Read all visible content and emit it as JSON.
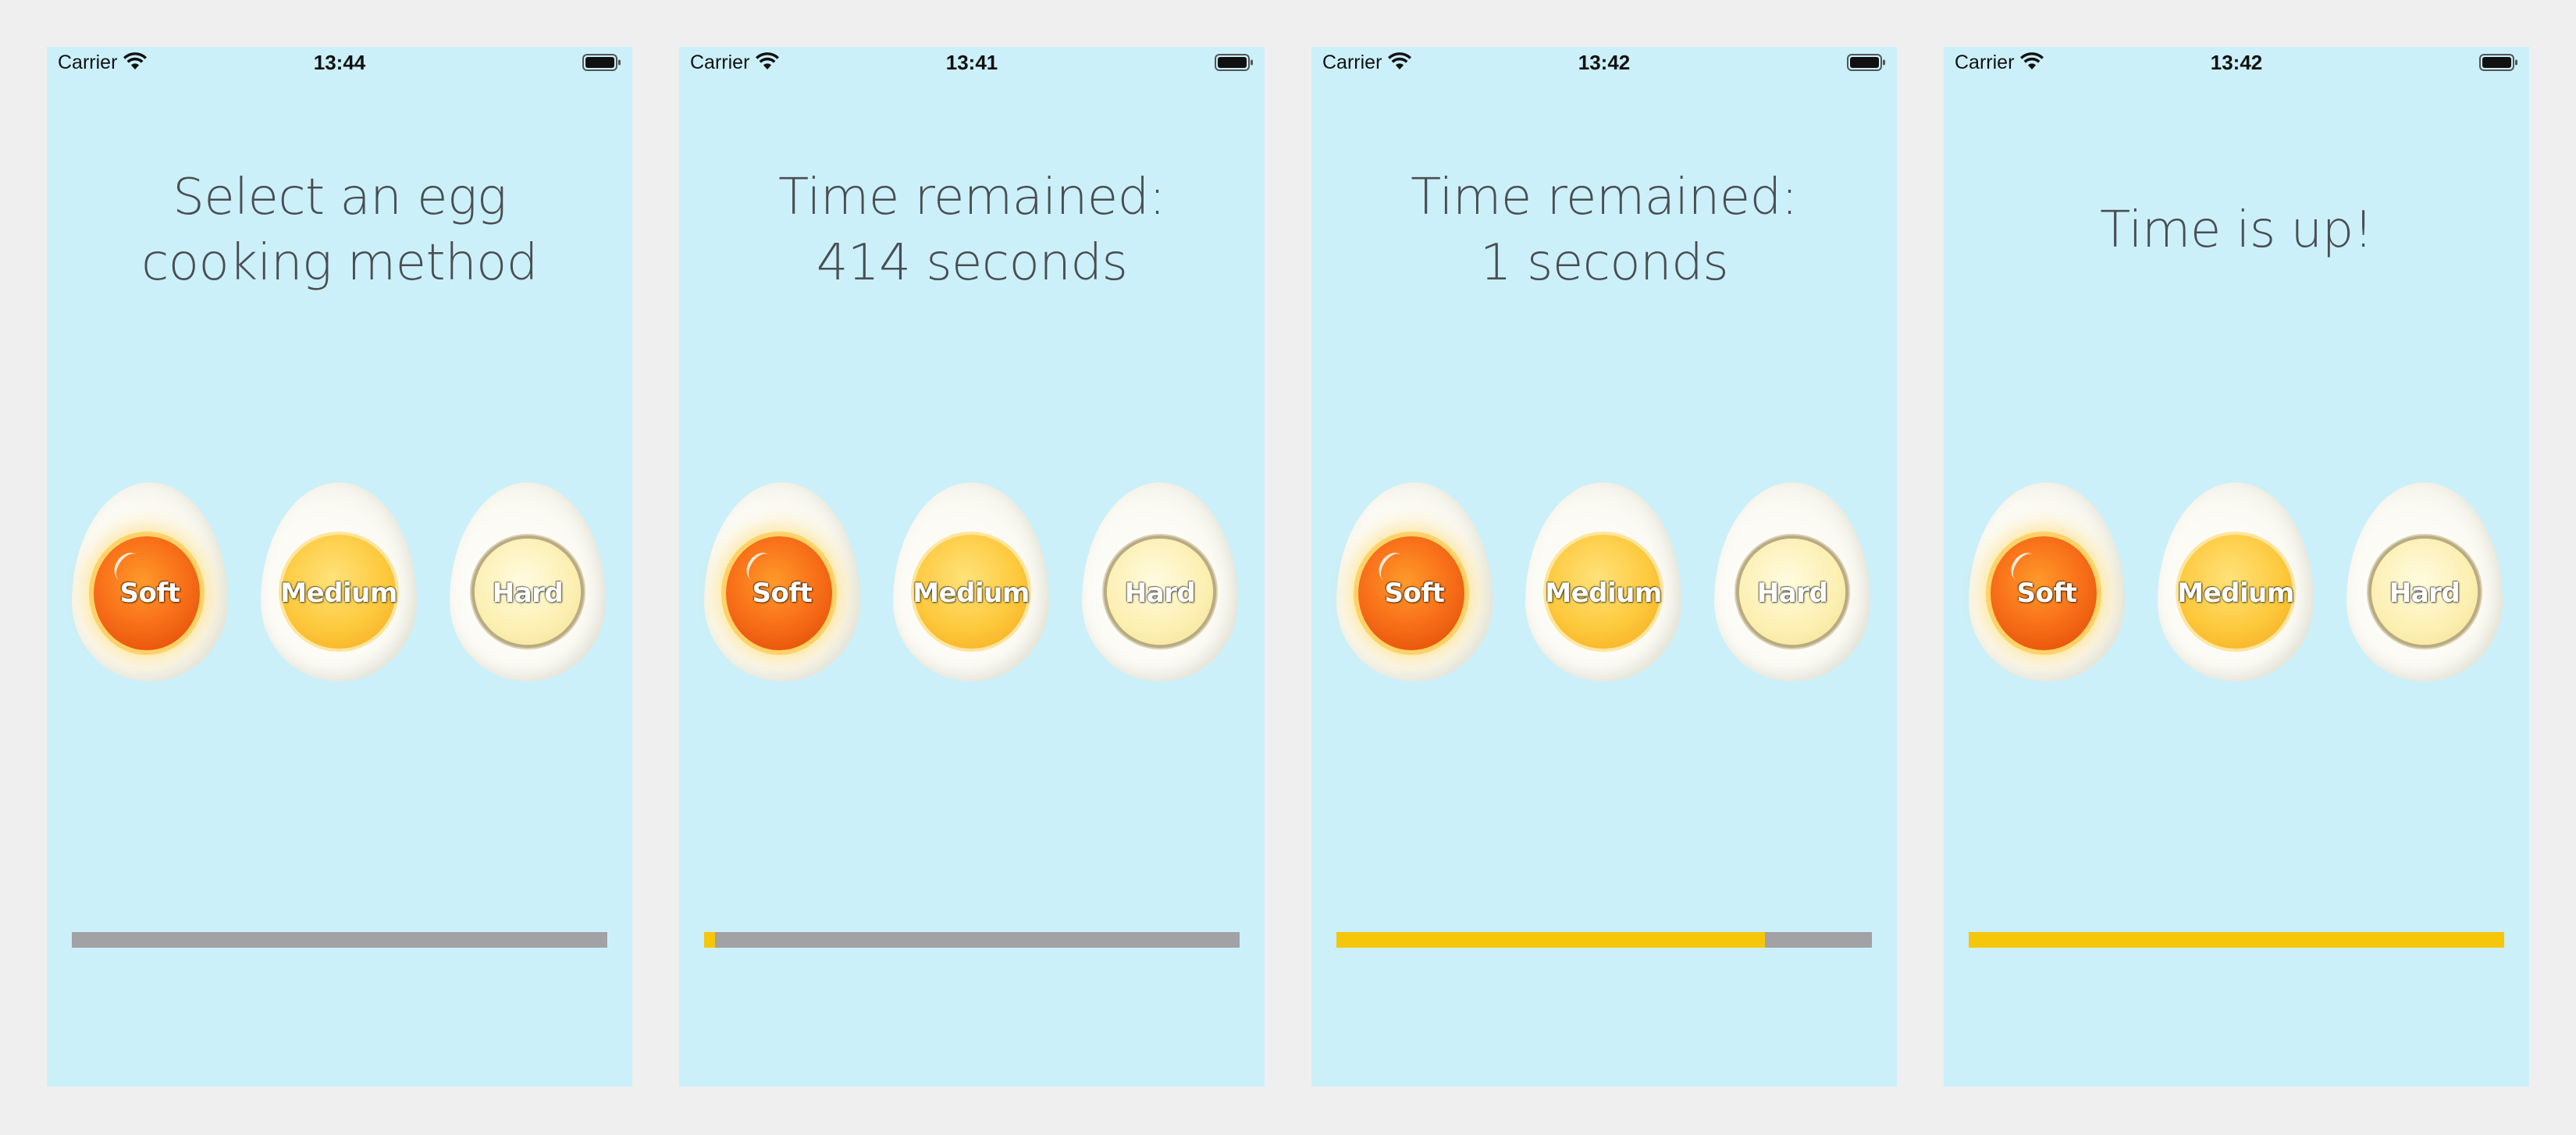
{
  "colors": {
    "background": "#cbf0f9",
    "progress_track": "#a1a1a6",
    "progress_fill": "#f5c60a"
  },
  "icons": [
    "wifi-icon",
    "battery-icon"
  ],
  "screens": [
    {
      "status": {
        "carrier": "Carrier",
        "time": "13:44"
      },
      "title": "Select an egg\ncooking method",
      "eggs": [
        {
          "label": "Soft"
        },
        {
          "label": "Medium"
        },
        {
          "label": "Hard"
        }
      ],
      "progress": 0
    },
    {
      "status": {
        "carrier": "Carrier",
        "time": "13:41"
      },
      "title": "Time remained:\n414 seconds",
      "eggs": [
        {
          "label": "Soft"
        },
        {
          "label": "Medium"
        },
        {
          "label": "Hard"
        }
      ],
      "progress": 0.02
    },
    {
      "status": {
        "carrier": "Carrier",
        "time": "13:42"
      },
      "title": "Time remained:\n1 seconds",
      "eggs": [
        {
          "label": "Soft"
        },
        {
          "label": "Medium"
        },
        {
          "label": "Hard"
        }
      ],
      "progress": 0.8
    },
    {
      "status": {
        "carrier": "Carrier",
        "time": "13:42"
      },
      "title": "Time is up!",
      "eggs": [
        {
          "label": "Soft"
        },
        {
          "label": "Medium"
        },
        {
          "label": "Hard"
        }
      ],
      "progress": 1.0
    }
  ]
}
